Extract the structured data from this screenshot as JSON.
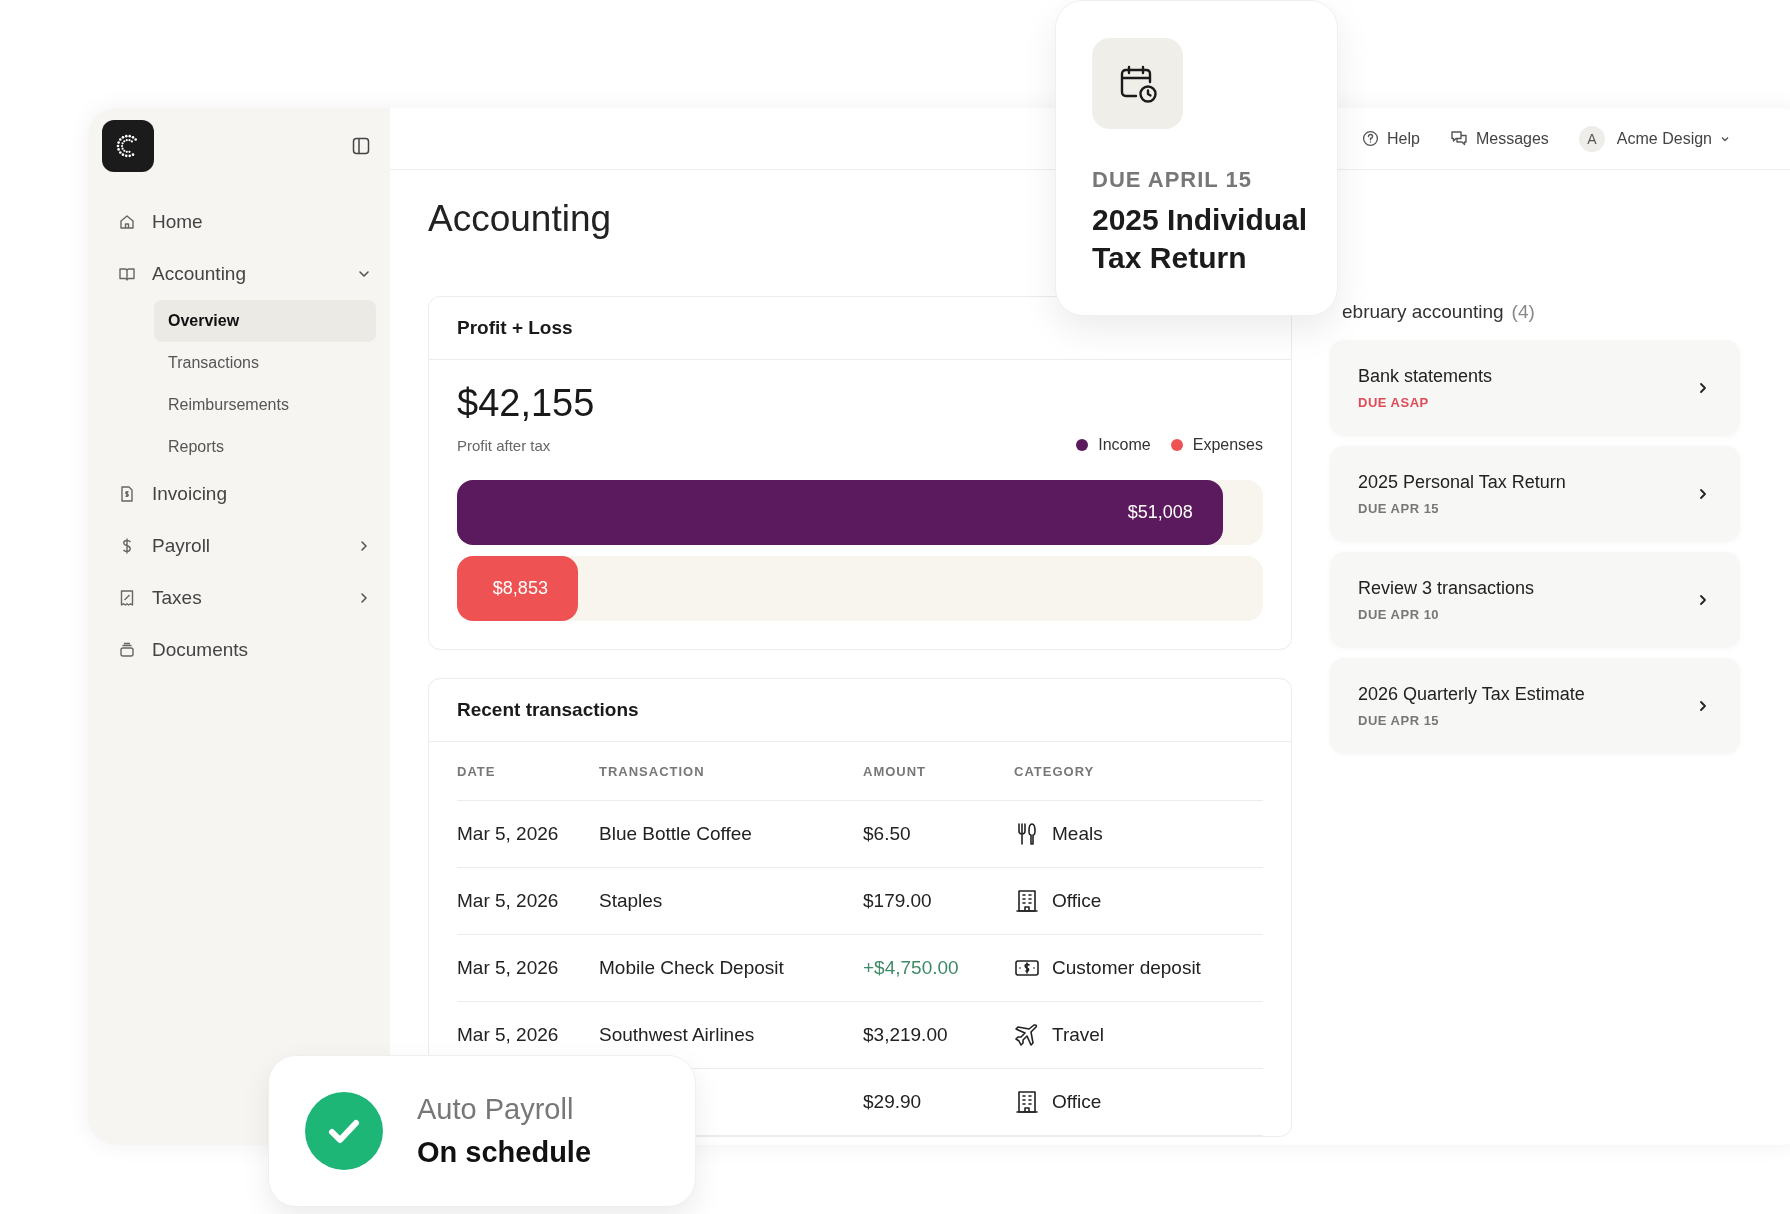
{
  "sidebar": {
    "items": [
      {
        "label": "Home",
        "kind": "home"
      },
      {
        "label": "Accounting",
        "kind": "book",
        "expanded": true,
        "children": [
          {
            "label": "Overview",
            "selected": true
          },
          {
            "label": "Transactions",
            "selected": false
          },
          {
            "label": "Reimbursements",
            "selected": false
          },
          {
            "label": "Reports",
            "selected": false
          }
        ]
      },
      {
        "label": "Invoicing",
        "kind": "invoice"
      },
      {
        "label": "Payroll",
        "kind": "dollar",
        "expanded": false
      },
      {
        "label": "Taxes",
        "kind": "receipt",
        "expanded": false
      },
      {
        "label": "Documents",
        "kind": "archive"
      }
    ]
  },
  "header": {
    "links": [
      {
        "label": "Help",
        "kind": "help"
      },
      {
        "label": "Messages",
        "kind": "messages"
      }
    ],
    "account": {
      "initial": "A",
      "name": "Acme Design"
    }
  },
  "page": {
    "title": "Accounting"
  },
  "profit": {
    "title": "Profit + Loss",
    "amount": "$42,155",
    "caption": "Profit after tax",
    "legend": [
      {
        "label": "Income",
        "color": "#5c1a5e"
      },
      {
        "label": "Expenses",
        "color": "#ee5253"
      }
    ],
    "bars": [
      {
        "value": "$51,008",
        "level": 0.95,
        "color": "#5c1a5e"
      },
      {
        "value": "$8,853",
        "level": 0.15,
        "color": "#ee5253"
      }
    ]
  },
  "transactions": {
    "title": "Recent transactions",
    "columns": [
      "DATE",
      "TRANSACTION",
      "AMOUNT",
      "CATEGORY"
    ],
    "rows": [
      {
        "date": "Mar 5, 2026",
        "name": "Blue Bottle Coffee",
        "amount": "$6.50",
        "incoming": false,
        "category": {
          "label": "Meals",
          "kind": "meals"
        }
      },
      {
        "date": "Mar 5, 2026",
        "name": "Staples",
        "amount": "$179.00",
        "incoming": false,
        "category": {
          "label": "Office",
          "kind": "office"
        }
      },
      {
        "date": "Mar 5, 2026",
        "name": "Mobile Check Deposit",
        "amount": "+$4,750.00",
        "incoming": true,
        "category": {
          "label": "Customer deposit",
          "kind": "deposit"
        }
      },
      {
        "date": "Mar 5, 2026",
        "name": "Southwest Airlines",
        "amount": "$3,219.00",
        "incoming": false,
        "category": {
          "label": "Travel",
          "kind": "travel"
        }
      },
      {
        "amount": "$29.90",
        "incoming": false,
        "category": {
          "label": "Office",
          "kind": "office"
        }
      }
    ]
  },
  "tasks": {
    "heading": "ebruary accounting",
    "count": "(4)",
    "items": [
      {
        "title": "Bank statements",
        "due": "DUE ASAP",
        "urgent": true
      },
      {
        "title": "2025 Personal Tax Return",
        "due": "DUE APR 15",
        "urgent": false
      },
      {
        "title": "Review 3 transactions",
        "due": "DUE APR 10",
        "urgent": false
      },
      {
        "title": "2026 Quarterly Tax Estimate",
        "due": "DUE APR 15",
        "urgent": false
      }
    ]
  },
  "deadline_card": {
    "due": "DUE APRIL 15",
    "title": "2025 Individual Tax Return"
  },
  "payroll_toast": {
    "title": "Auto Payroll",
    "status": "On schedule"
  }
}
